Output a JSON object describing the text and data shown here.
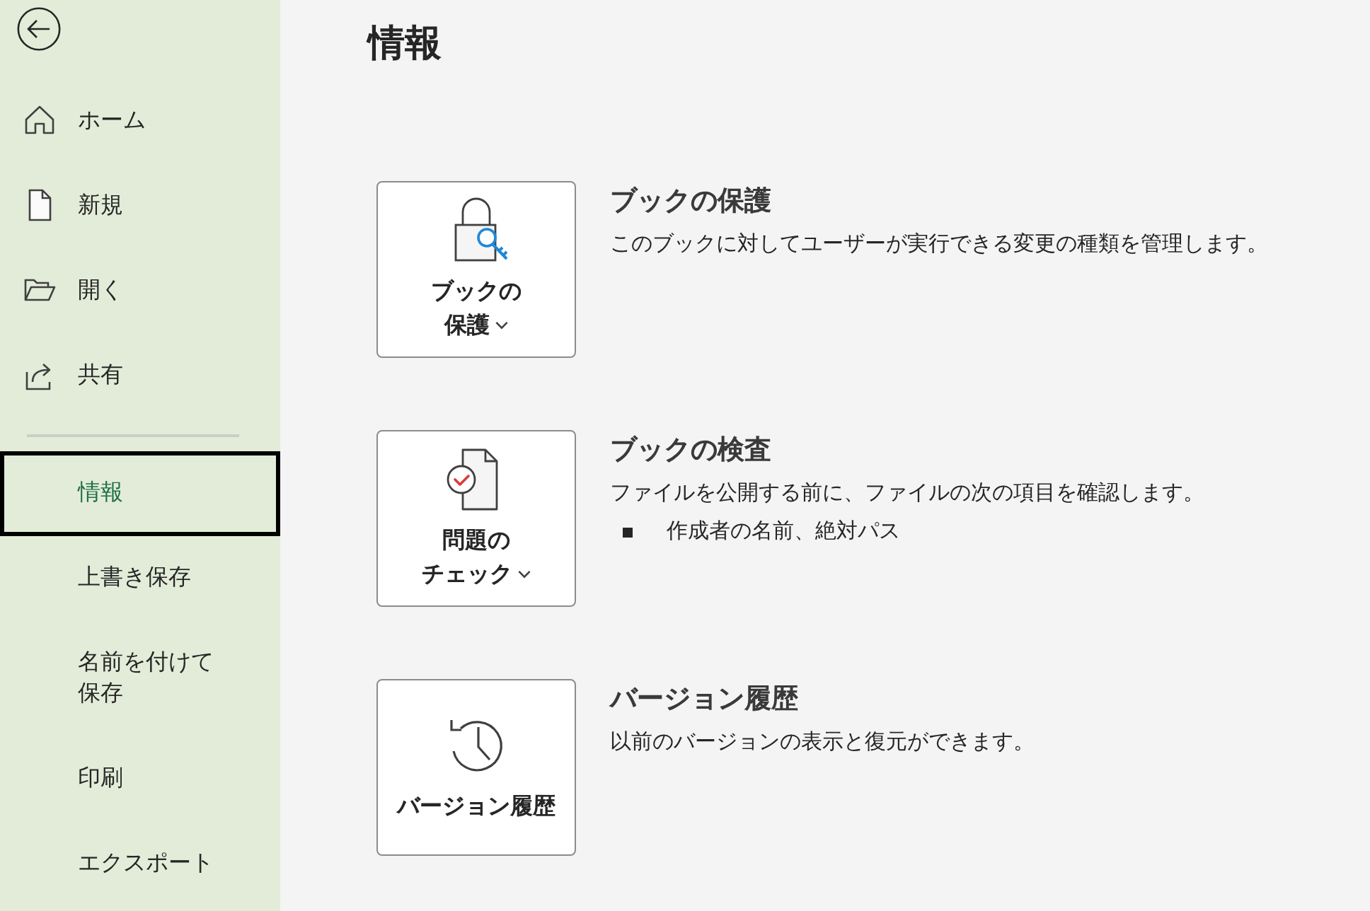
{
  "sidebar": {
    "nav_items": [
      {
        "label": "ホーム",
        "selected": false
      },
      {
        "label": "新規",
        "selected": false
      },
      {
        "label": "開く",
        "selected": false
      },
      {
        "label": "共有",
        "selected": false
      }
    ],
    "file_items": [
      {
        "label": "情報",
        "selected": true
      },
      {
        "label": "上書き保存",
        "selected": false
      },
      {
        "label": "名前を付けて保存",
        "selected": false
      },
      {
        "label": "印刷",
        "selected": false
      },
      {
        "label": "エクスポート",
        "selected": false
      }
    ]
  },
  "page": {
    "title": "情報",
    "sections": [
      {
        "button": {
          "label": "ブックの保護",
          "dropdown": true
        },
        "heading": "ブックの保護",
        "description": "このブックに対してユーザーが実行できる変更の種類を管理します。"
      },
      {
        "button": {
          "label": "問題のチェック",
          "dropdown": true
        },
        "heading": "ブックの検査",
        "description": "ファイルを公開する前に、ファイルの次の項目を確認します。",
        "bullets": [
          "作成者の名前、絶対パス"
        ]
      },
      {
        "button": {
          "label": "バージョン履歴",
          "dropdown": false
        },
        "heading": "バージョン履歴",
        "description": "以前のバージョンの表示と復元ができます。"
      }
    ]
  }
}
